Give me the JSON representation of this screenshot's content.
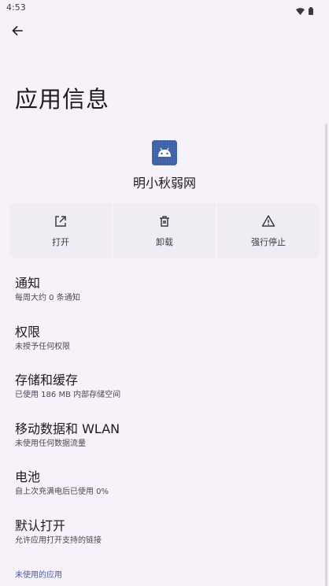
{
  "status_bar": {
    "time": "4:53",
    "icons": [
      "wifi-icon",
      "battery-icon"
    ]
  },
  "header": {
    "back_icon": "arrow-left-icon",
    "title": "应用信息"
  },
  "app": {
    "name": "明小秋弱网",
    "icon": "android-robot-icon",
    "icon_bg": "#3b5fa3"
  },
  "actions": [
    {
      "label": "打开",
      "icon": "open-external-icon"
    },
    {
      "label": "卸载",
      "icon": "trash-icon"
    },
    {
      "label": "强行停止",
      "icon": "warning-triangle-icon"
    }
  ],
  "settings": [
    {
      "title": "通知",
      "subtitle": "每周大约 0 条通知"
    },
    {
      "title": "权限",
      "subtitle": "未授予任何权限"
    },
    {
      "title": "存储和缓存",
      "subtitle": "已使用 186 MB 内部存储空间"
    },
    {
      "title": "移动数据和 WLAN",
      "subtitle": "未使用任何数据流量"
    },
    {
      "title": "电池",
      "subtitle": "自上次充满电后已使用 0%"
    },
    {
      "title": "默认打开",
      "subtitle": "允许应用打开支持的链接"
    }
  ],
  "unused_section": {
    "label": "未使用的应用"
  },
  "colors": {
    "background": "#f7f2f9",
    "accent": "#4a5aa8",
    "card": "#f0ecf4"
  }
}
